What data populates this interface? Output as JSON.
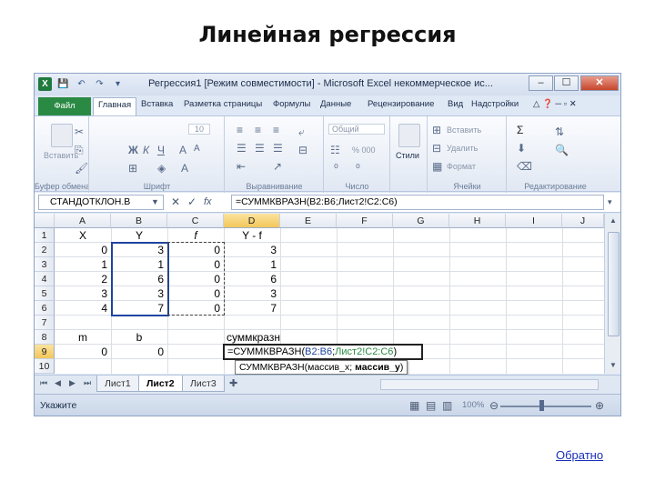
{
  "slide": {
    "title": "Линейная регрессия",
    "back_link": "Обратно"
  },
  "window": {
    "title": "Регрессия1 [Режим совместимости] - Microsoft Excel некоммерческое ис..."
  },
  "ribbon_tabs": [
    "Файл",
    "Главная",
    "Вставка",
    "Разметка страницы",
    "Формулы",
    "Данные",
    "Рецензирование",
    "Вид",
    "Надстройки"
  ],
  "ribbon": {
    "paste": "Вставить",
    "font_size": "10",
    "number_format": "Общий",
    "percent": "% 000",
    "styles": "Стили",
    "insert": "Вставить",
    "delete": "Удалить",
    "format": "Формат",
    "sigma": "Σ",
    "groups": [
      "Буфер обмена",
      "Шрифт",
      "Выравнивание",
      "Число",
      "Ячейки",
      "Редактирование"
    ]
  },
  "formula_bar": {
    "name_box": "СТАНДОТКЛОН.В",
    "fx": "fx",
    "formula": "=СУММКВРАЗН(B2:B6;Лист2!C2:C6)"
  },
  "columns": [
    "A",
    "B",
    "C",
    "D",
    "E",
    "F",
    "G",
    "H",
    "I",
    "J"
  ],
  "rows": [
    "1",
    "2",
    "3",
    "4",
    "5",
    "6",
    "7",
    "8",
    "9",
    "10"
  ],
  "cells": {
    "A1": "X",
    "B1": "Y",
    "C1": "f",
    "D1": "Y - f",
    "A2": "0",
    "B2": "3",
    "C2": "0",
    "D2": "3",
    "A3": "1",
    "B3": "1",
    "C3": "0",
    "D3": "1",
    "A4": "2",
    "B4": "6",
    "C4": "0",
    "D4": "6",
    "A5": "3",
    "B5": "3",
    "C5": "0",
    "D5": "3",
    "A6": "4",
    "B6": "7",
    "C6": "0",
    "D6": "7",
    "D8": "суммкразн",
    "A8": "m",
    "B8": "b",
    "A9": "0",
    "B9": "0",
    "D9_prefix": "=СУММКВРАЗН(",
    "D9_ref1": "B2:B6",
    "D9_sep": ";",
    "D9_ref2": "Лист2!C2:C6",
    "D9_suffix": ")"
  },
  "tooltip": {
    "func": "СУММКВРАЗН(массив_x; ",
    "arg": "массив_y",
    "close": ")"
  },
  "sheets": [
    "Лист1",
    "Лист2",
    "Лист3"
  ],
  "active_sheet": "Лист2",
  "status": {
    "mode": "Укажите",
    "zoom": "100%"
  },
  "colors": {
    "excel_green": "#2a8a44",
    "selection_blue": "#1f44a0",
    "header_highlight": "#f3c75a"
  }
}
